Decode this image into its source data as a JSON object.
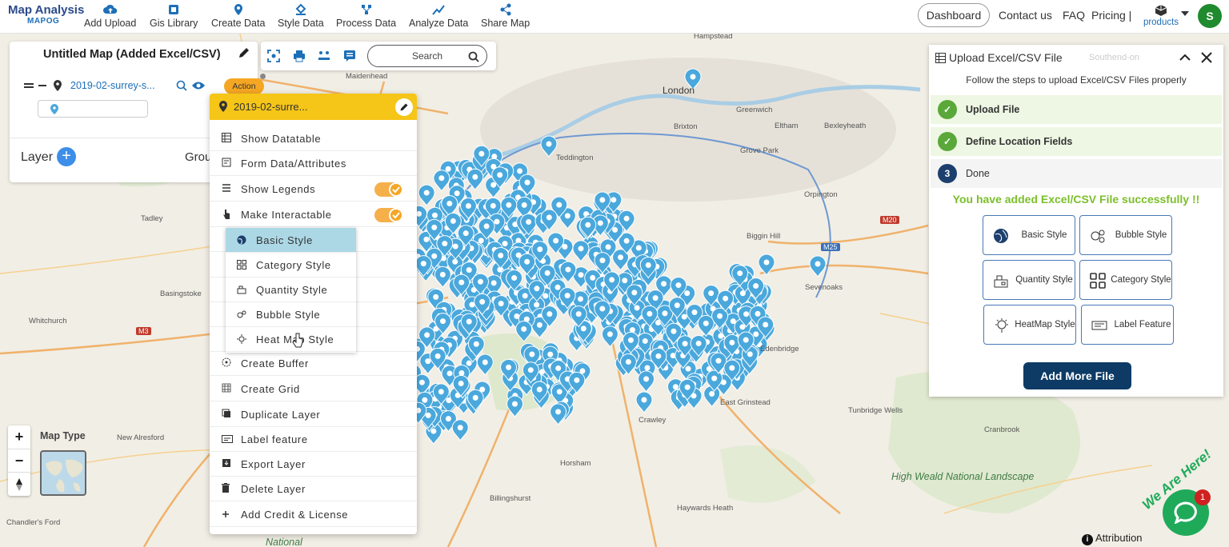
{
  "logo": {
    "line1": "Map Analysis",
    "line2": "MAPOG"
  },
  "nav": [
    {
      "label": "Add Upload",
      "icon": "cloud-upload-icon"
    },
    {
      "label": "Gis Library",
      "icon": "library-icon"
    },
    {
      "label": "Create Data",
      "icon": "map-pin-icon"
    },
    {
      "label": "Style Data",
      "icon": "paint-bucket-icon"
    },
    {
      "label": "Process Data",
      "icon": "process-icon"
    },
    {
      "label": "Analyze Data",
      "icon": "analyze-icon"
    },
    {
      "label": "Share Map",
      "icon": "share-icon"
    }
  ],
  "topright": {
    "dashboard": "Dashboard",
    "contact": "Contact us",
    "faq": "FAQ",
    "pricing": "Pricing |",
    "products": "products",
    "avatar": "S"
  },
  "layer_panel": {
    "map_title": "Untitled Map (Added Excel/CSV)",
    "layer_name": "2019-02-surrey-s...",
    "action": "Action",
    "layer_label": "Layer",
    "add": "+",
    "group_label": "Grou"
  },
  "toolbar": {
    "search_placeholder": "Search"
  },
  "dropdown": {
    "header": "2019-02-surre...",
    "items": [
      {
        "label": "Show Datatable",
        "icon": "table-icon"
      },
      {
        "label": "Form Data/Attributes",
        "icon": "form-icon"
      },
      {
        "label": "Show Legends",
        "icon": "list-icon",
        "toggle": true
      },
      {
        "label": "Make Interactable",
        "icon": "pointer-icon",
        "toggle": true
      },
      {
        "label": "",
        "icon": ""
      },
      {
        "label": "",
        "icon": ""
      },
      {
        "label": "",
        "icon": ""
      },
      {
        "label": "",
        "icon": ""
      },
      {
        "label": "",
        "icon": ""
      },
      {
        "label": "Create Buffer",
        "icon": "buffer-icon"
      },
      {
        "label": "Create Grid",
        "icon": "grid-icon"
      },
      {
        "label": "Duplicate Layer",
        "icon": "duplicate-icon"
      },
      {
        "label": "Label feature",
        "icon": "label-icon"
      },
      {
        "label": "Export Layer",
        "icon": "export-icon"
      },
      {
        "label": "Delete Layer",
        "icon": "trash-icon"
      },
      {
        "label": "Add Credit & License",
        "icon": "plus-icon"
      }
    ],
    "style_submenu": [
      {
        "label": "Basic Style",
        "active": true
      },
      {
        "label": "Category Style"
      },
      {
        "label": "Quantity Style"
      },
      {
        "label": "Bubble Style"
      },
      {
        "label": "Heat Map Style"
      }
    ]
  },
  "map_controls": {
    "zoom_in": "+",
    "zoom_out": "−",
    "map_type": "Map Type"
  },
  "map_labels": {
    "london": "London",
    "crawley": "Crawley",
    "horsham": "Horsham",
    "sevenoaks": "Sevenoaks",
    "edenbridge": "Edenbridge",
    "biggin_hill": "Biggin Hill",
    "high_weald": "High Weald National Landscape",
    "whitchurch": "Whitchurch",
    "basingstoke": "Basingstoke",
    "new_alresford": "New Alresford",
    "tadley": "Tadley",
    "hampstead": "Hampstead",
    "greenwich": "Greenwich",
    "bexleyheath": "Bexleyheath",
    "cranbrook": "Cranbrook",
    "tunbridge": "Tunbridge Wells",
    "grinstead": "East Grinstead",
    "haywards": "Haywards Heath",
    "billingshurst": "Billingshurst",
    "brixton": "Brixton",
    "m25": "M25",
    "m20": "M20",
    "m3": "M3",
    "national": "National",
    "chandlers": "Chandler's Ford",
    "maidenhead": "Maidenhead",
    "teddington": "Teddington",
    "grove_park": "Grove Park",
    "orpington": "Orpington",
    "eltham": "Eltham"
  },
  "upload_panel": {
    "title": "Upload Excel/CSV File",
    "faded": "Southend-on",
    "subtitle": "Follow the steps to upload Excel/CSV Files properly",
    "steps": [
      {
        "label": "Upload File",
        "state": "done"
      },
      {
        "label": "Define Location Fields",
        "state": "done"
      },
      {
        "label": "Done",
        "state": "current",
        "num": "3"
      }
    ],
    "success": "You have added Excel/CSV File successfully !!",
    "style_buttons": [
      {
        "label": "Basic Style",
        "icon": "globe-icon"
      },
      {
        "label": "Bubble Style",
        "icon": "bubble-icon"
      },
      {
        "label": "Quantity Style",
        "icon": "quantity-icon"
      },
      {
        "label": "Category Style",
        "icon": "category-icon"
      },
      {
        "label": "HeatMap Style",
        "icon": "heatmap-icon"
      },
      {
        "label": "Label Feature",
        "icon": "label-icon"
      }
    ],
    "add_more": "Add More File"
  },
  "attribution": "Attribution",
  "chat_badge": "1",
  "we_are_here": "We Are Here!",
  "colors": {
    "pin": "#4aa8dc",
    "brand": "#0d3b66",
    "action": "#f5a623",
    "success": "#7bbf2a"
  }
}
